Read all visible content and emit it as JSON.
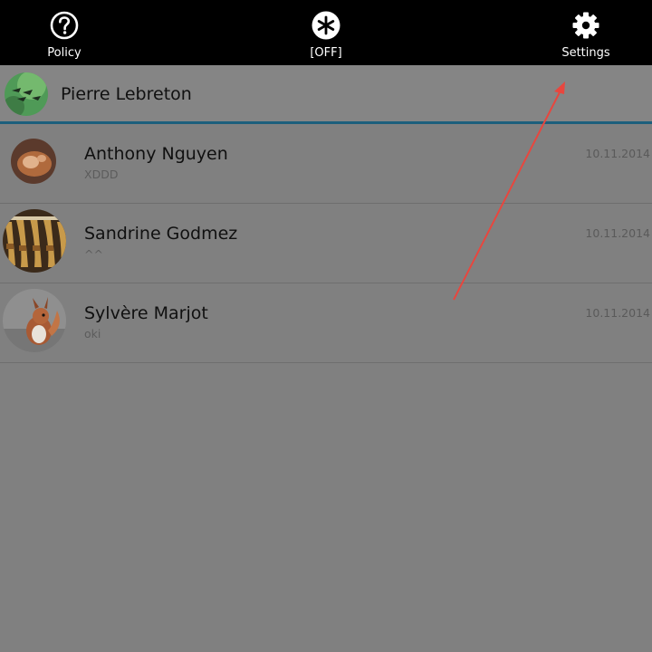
{
  "toolbar": {
    "actions": [
      {
        "label": "Policy",
        "icon": "help-circle-icon"
      },
      {
        "label": "[OFF]",
        "icon": "asterisk-icon"
      },
      {
        "label": "Settings",
        "icon": "gear-icon"
      }
    ]
  },
  "account": {
    "name": "Pierre Lebreton",
    "accent_color": "#1c5f7c"
  },
  "conversations": [
    {
      "name": "Anthony Nguyen",
      "preview": "XDDD",
      "date": "10.11.2014"
    },
    {
      "name": "Sandrine Godmez",
      "preview": "^^",
      "date": "10.11.2014"
    },
    {
      "name": "Sylvère Marjot",
      "preview": "oki",
      "date": "10.11.2014"
    }
  ],
  "annotation": {
    "color": "#e8463e"
  }
}
